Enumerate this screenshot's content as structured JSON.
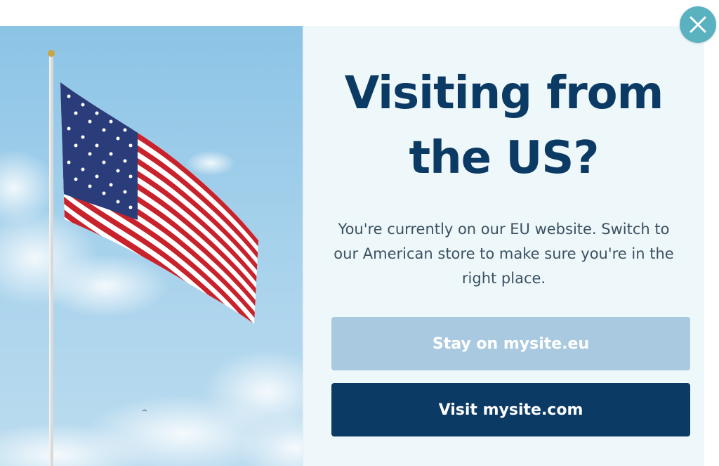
{
  "popup": {
    "headline": "Visiting from the US?",
    "description": "You're currently on our EU website. Switch to our American store to make sure you're in the right place.",
    "stay_label": "Stay on mysite.eu",
    "visit_label": "Visit mysite.com"
  },
  "icons": {
    "close": "close-icon"
  },
  "colors": {
    "headline": "#0b3a64",
    "primary_button": "#0b3a64",
    "secondary_button": "#a9c9e0",
    "close_button": "#5ab2c1",
    "panel_background": "#eef7fa"
  }
}
